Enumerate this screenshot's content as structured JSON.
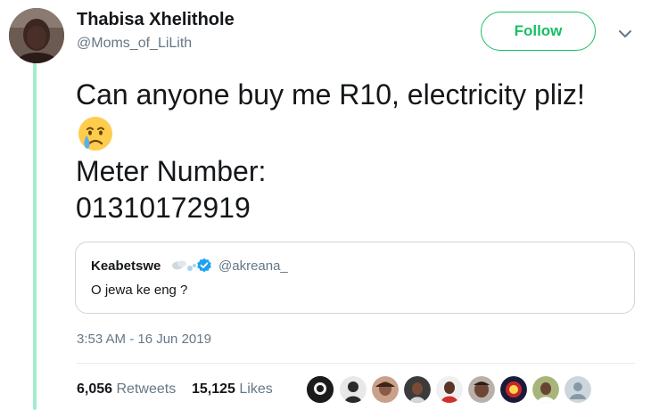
{
  "author": {
    "display_name": "Thabisa Xhelithole",
    "handle": "@Moms_of_LiLith"
  },
  "follow_button": {
    "label": "Follow"
  },
  "tweet": {
    "line1": "Can anyone buy me R10, electricity pliz!",
    "emoji": "crying-face",
    "line3": "Meter Number:",
    "line4": "01310172919"
  },
  "quoted_tweet": {
    "display_name": "Keabetswe",
    "handle": "@akreana_",
    "text": "O jewa ke eng ?",
    "verified": true
  },
  "timestamp": "3:53 AM - 16 Jun 2019",
  "stats": {
    "retweets_count": "6,056",
    "retweets_label": "Retweets",
    "likes_count": "15,125",
    "likes_label": "Likes"
  },
  "colors": {
    "follow_green": "#17bf63",
    "verified_blue": "#1da1f2",
    "thread_line": "#a3ecd0",
    "muted_text": "#657786"
  }
}
